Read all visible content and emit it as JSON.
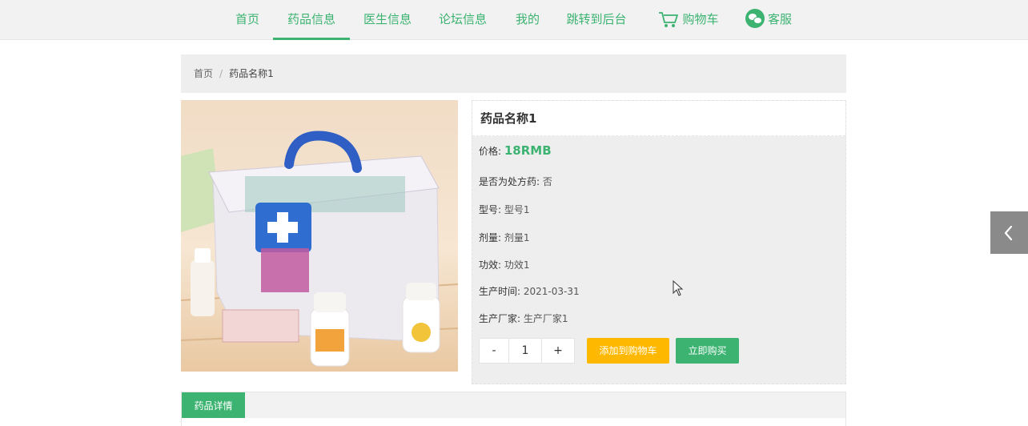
{
  "nav": {
    "items": [
      {
        "label": "首页"
      },
      {
        "label": "药品信息"
      },
      {
        "label": "医生信息"
      },
      {
        "label": "论坛信息"
      },
      {
        "label": "我的"
      },
      {
        "label": "跳转到后台"
      },
      {
        "label": "购物车"
      },
      {
        "label": "客服"
      }
    ],
    "active_index": 1
  },
  "breadcrumb": {
    "home": "首页",
    "separator": "/",
    "current": "药品名称1"
  },
  "product": {
    "name": "药品名称1",
    "price_label": "价格:",
    "price_value": "18RMB",
    "fields": [
      {
        "label": "是否为处方药:",
        "value": "否"
      },
      {
        "label": "型号:",
        "value": "型号1"
      },
      {
        "label": "剂量:",
        "value": "剂量1"
      },
      {
        "label": "功效:",
        "value": "功效1"
      },
      {
        "label": "生产时间:",
        "value": "2021-03-31"
      },
      {
        "label": "生产厂家:",
        "value": "生产厂家1"
      }
    ],
    "quantity": {
      "minus": "-",
      "value": "1",
      "plus": "+"
    },
    "add_to_cart": "添加到购物车",
    "buy_now": "立即购买"
  },
  "detail": {
    "tab_label": "药品详情"
  },
  "colors": {
    "accent": "#3cb371",
    "cart_button": "#ffb800",
    "panel_bg": "#eeeeef"
  },
  "icons": {
    "cart": "cart-icon",
    "service": "wechat-icon",
    "side": "chevron-left-icon"
  }
}
